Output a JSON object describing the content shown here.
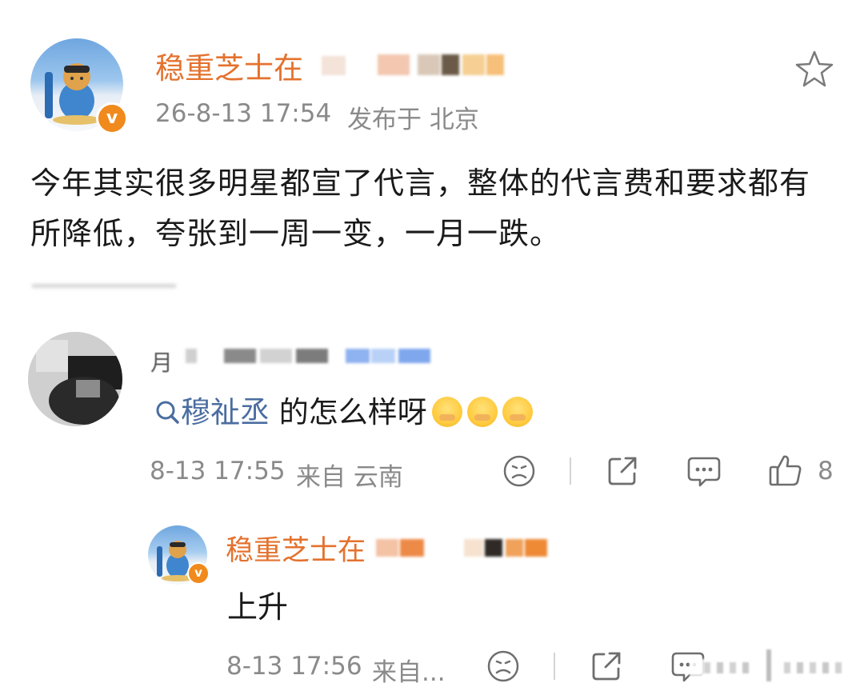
{
  "post": {
    "author": "稳重芝士在",
    "time": "26-8-13 17:54",
    "location": "发布于 北京",
    "text": "今年其实很多明星都宣了代言，整体的代言费和要求都有所降低，夸张到一周一变，一月一跌。"
  },
  "comment": {
    "author_partial": "月",
    "mention": "穆祉丞",
    "text": " 的怎么样呀",
    "time": "8-13 17:55",
    "location": "来自 云南",
    "likes": "8"
  },
  "reply": {
    "author": "稳重芝士在",
    "text": "上升",
    "time": "8-13 17:56",
    "location": "来自..."
  },
  "colors": {
    "username": "#e4722e",
    "meta": "#8a8a8a",
    "mention": "#4a6da0",
    "verified_badge": "#f08a1c"
  },
  "icons": [
    "star-icon",
    "search-icon",
    "dislike-icon",
    "share-icon",
    "comment-icon",
    "like-icon",
    "verified-badge-icon",
    "laugh-cry-emoji"
  ]
}
